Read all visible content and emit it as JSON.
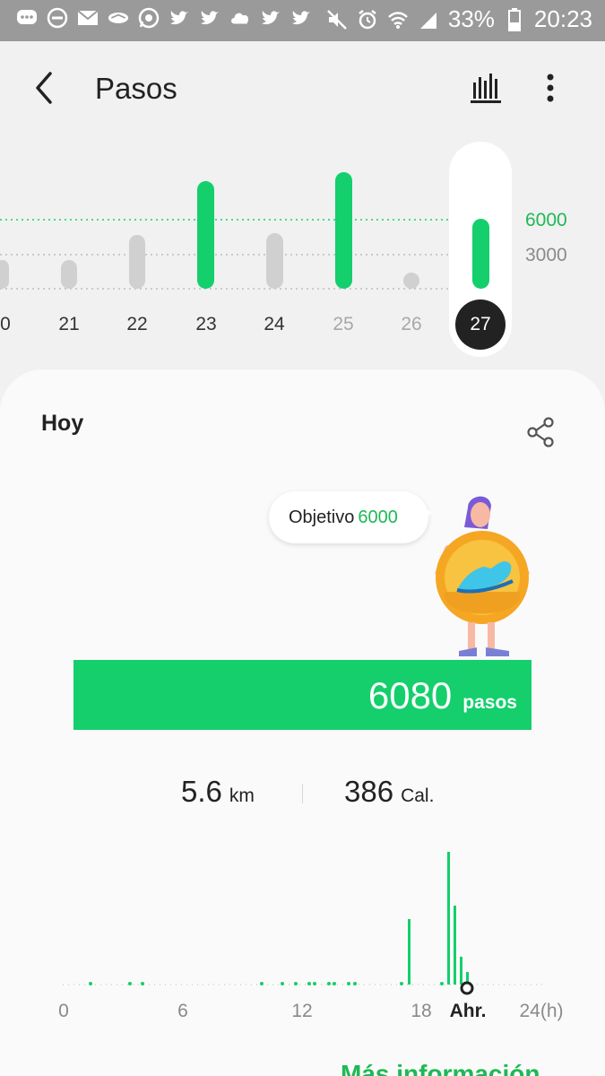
{
  "status_bar": {
    "battery_percent": "33%",
    "time": "20:23",
    "icons_left": [
      "chat-icon",
      "do-not-disturb-icon",
      "mail-icon",
      "handshake-icon",
      "whatsapp-icon",
      "twitter-icon",
      "twitter-icon",
      "cloud-icon",
      "twitter-icon",
      "twitter-icon"
    ],
    "icons_right": [
      "mute-icon",
      "alarm-icon",
      "wifi-icon",
      "signal-icon",
      "battery-icon"
    ]
  },
  "app_bar": {
    "title": "Pasos"
  },
  "weekly": {
    "goal_label": "6000",
    "base_label": "3000",
    "days": [
      "0",
      "21",
      "22",
      "23",
      "24",
      "25",
      "26",
      "27"
    ],
    "selected_day": "27",
    "accent": "#14cf6c"
  },
  "today": {
    "heading": "Hoy",
    "goal_prefix": "Objetivo",
    "goal_value": "6000",
    "steps": "6080",
    "steps_unit": "pasos",
    "distance": "5.6",
    "distance_unit": "km",
    "calories": "386",
    "calories_unit": "Cal."
  },
  "hourly": {
    "x_labels": [
      "0",
      "6",
      "12",
      "18",
      "Ahr.",
      "24(h)"
    ]
  },
  "footer_peek": "Más información"
}
